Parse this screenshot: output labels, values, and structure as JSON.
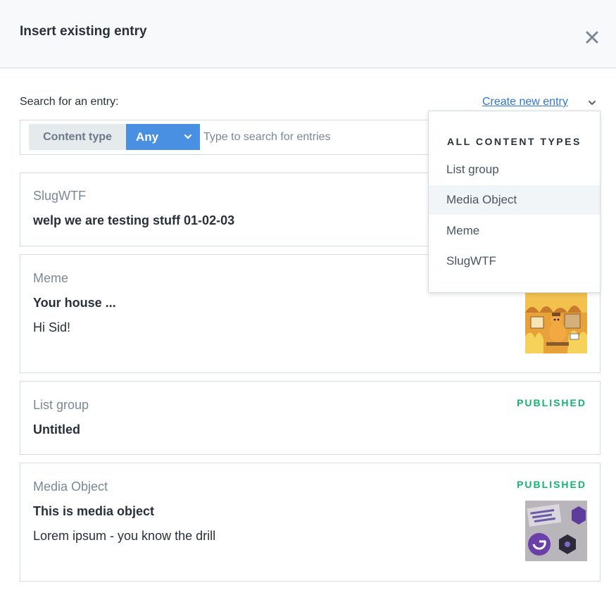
{
  "modal": {
    "title": "Insert existing entry",
    "close_icon": "close-icon"
  },
  "search": {
    "label": "Search for an entry:",
    "create_link": "Create new entry",
    "content_type_label": "Content type",
    "content_type_value": "Any",
    "placeholder": "Type to search for entries"
  },
  "dropdown": {
    "heading": "ALL CONTENT TYPES",
    "items": [
      "List group",
      "Media Object",
      "Meme",
      "SlugWTF"
    ],
    "hovered_item": "Media Object"
  },
  "entries": [
    {
      "type": "SlugWTF",
      "title": "welp we are testing stuff 01-02-03",
      "description": "",
      "status": ""
    },
    {
      "type": "Meme",
      "title": "Your house ...",
      "description": "Hi Sid!",
      "status": ""
    },
    {
      "type": "List group",
      "title": "Untitled",
      "description": "",
      "status": "PUBLISHED"
    },
    {
      "type": "Media Object",
      "title": "This is media object",
      "description": "Lorem ipsum - you know the drill",
      "status": "PUBLISHED"
    }
  ],
  "colors": {
    "accent": "#4a90e2",
    "link": "#2e75d4",
    "published": "#14b374"
  }
}
